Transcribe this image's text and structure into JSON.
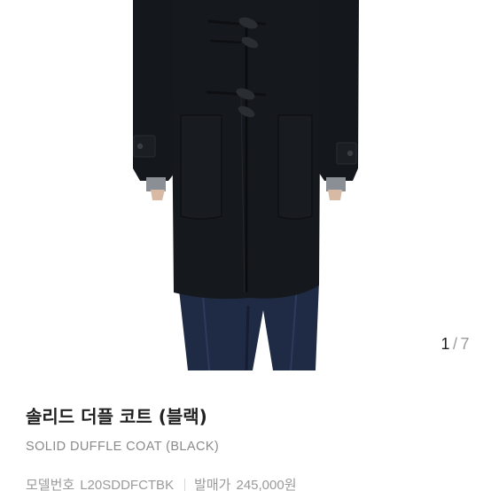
{
  "gallery": {
    "current": "1",
    "separator": "/",
    "total": "7"
  },
  "product": {
    "name_ko": "솔리드 더플 코트 (블랙)",
    "name_en": "SOLID DUFFLE COAT (BLACK)",
    "model_label": "모델번호",
    "model_value": "L20SDDFCTBK",
    "price_label": "발매가",
    "price_value": "245,000원"
  },
  "colors": {
    "coat": "#15181c",
    "jeans": "#1f2a44",
    "text_primary": "#222222",
    "text_secondary": "#8a8a8a"
  }
}
